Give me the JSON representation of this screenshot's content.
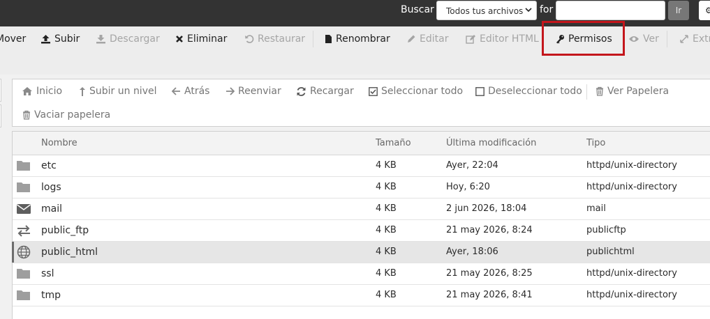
{
  "search": {
    "label": "Buscar",
    "scope_selected": "Todos tus archivos",
    "for_label": "for",
    "query_value": "",
    "go_label": "Ir",
    "settings_glyph": "⚙"
  },
  "toolbar": {
    "items": [
      {
        "label": "Mover",
        "visible_text": "Mover",
        "icon": "move-icon",
        "enabled": true
      },
      {
        "label": "Subir",
        "icon": "upload-icon",
        "enabled": true
      },
      {
        "label": "Descargar",
        "icon": "download-icon",
        "enabled": false
      },
      {
        "label": "Eliminar",
        "icon": "delete-icon",
        "enabled": true
      },
      {
        "label": "Restaurar",
        "icon": "restore-icon",
        "enabled": false
      },
      {
        "label": "Renombrar",
        "icon": "file-icon",
        "enabled": true
      },
      {
        "label": "Editar",
        "icon": "pencil-icon",
        "enabled": false
      },
      {
        "label": "Editor HTML",
        "icon": "edit-square-icon",
        "enabled": false
      },
      {
        "label": "Permisos",
        "icon": "key-icon",
        "enabled": true,
        "highlighted": true
      },
      {
        "label": "Ver",
        "icon": "eye-icon",
        "enabled": false
      },
      {
        "label": "Extraer",
        "icon": "expand-icon",
        "enabled": false
      }
    ],
    "highlight_color": "#c4161c"
  },
  "nav": {
    "items": [
      {
        "label": "Inicio",
        "icon": "home-icon"
      },
      {
        "label": "Subir un nivel",
        "icon": "level-up-icon"
      },
      {
        "label": "Atrás",
        "icon": "arrow-left-icon"
      },
      {
        "label": "Reenviar",
        "icon": "arrow-right-icon"
      },
      {
        "label": "Recargar",
        "icon": "refresh-icon"
      },
      {
        "label": "Seleccionar todo",
        "icon": "checkbox-checked-icon"
      },
      {
        "label": "Deseleccionar todo",
        "icon": "checkbox-empty-icon"
      },
      {
        "label": "Ver Papelera",
        "icon": "trash-icon"
      },
      {
        "label": "Vaciar papelera",
        "icon": "trash-icon"
      }
    ]
  },
  "table": {
    "columns": [
      "Nombre",
      "Tamaño",
      "Última modificación",
      "Tipo"
    ],
    "rows": [
      {
        "name": "etc",
        "size": "4 KB",
        "modified": "Ayer, 22:04",
        "type": "httpd/unix-directory",
        "icon": "folder-icon"
      },
      {
        "name": "logs",
        "size": "4 KB",
        "modified": "Hoy, 6:20",
        "type": "httpd/unix-directory",
        "icon": "folder-icon"
      },
      {
        "name": "mail",
        "size": "4 KB",
        "modified": "2 jun 2026, 18:04",
        "type": "mail",
        "icon": "envelope-icon"
      },
      {
        "name": "public_ftp",
        "size": "4 KB",
        "modified": "21 may 2026, 8:24",
        "type": "publicftp",
        "icon": "transfer-icon"
      },
      {
        "name": "public_html",
        "size": "4 KB",
        "modified": "Ayer, 18:06",
        "type": "publichtml",
        "icon": "globe-icon",
        "selected": true
      },
      {
        "name": "ssl",
        "size": "4 KB",
        "modified": "21 may 2026, 8:25",
        "type": "httpd/unix-directory",
        "icon": "folder-icon"
      },
      {
        "name": "tmp",
        "size": "4 KB",
        "modified": "21 may 2026, 8:41",
        "type": "httpd/unix-directory",
        "icon": "folder-icon"
      }
    ]
  },
  "colors": {
    "topbar": "#333333",
    "toolbar_bg": "#ededed",
    "enabled_text": "#222222",
    "disabled_text": "#a5a5a5",
    "nav_text": "#757575",
    "selected_row": "#e6e6e6"
  }
}
